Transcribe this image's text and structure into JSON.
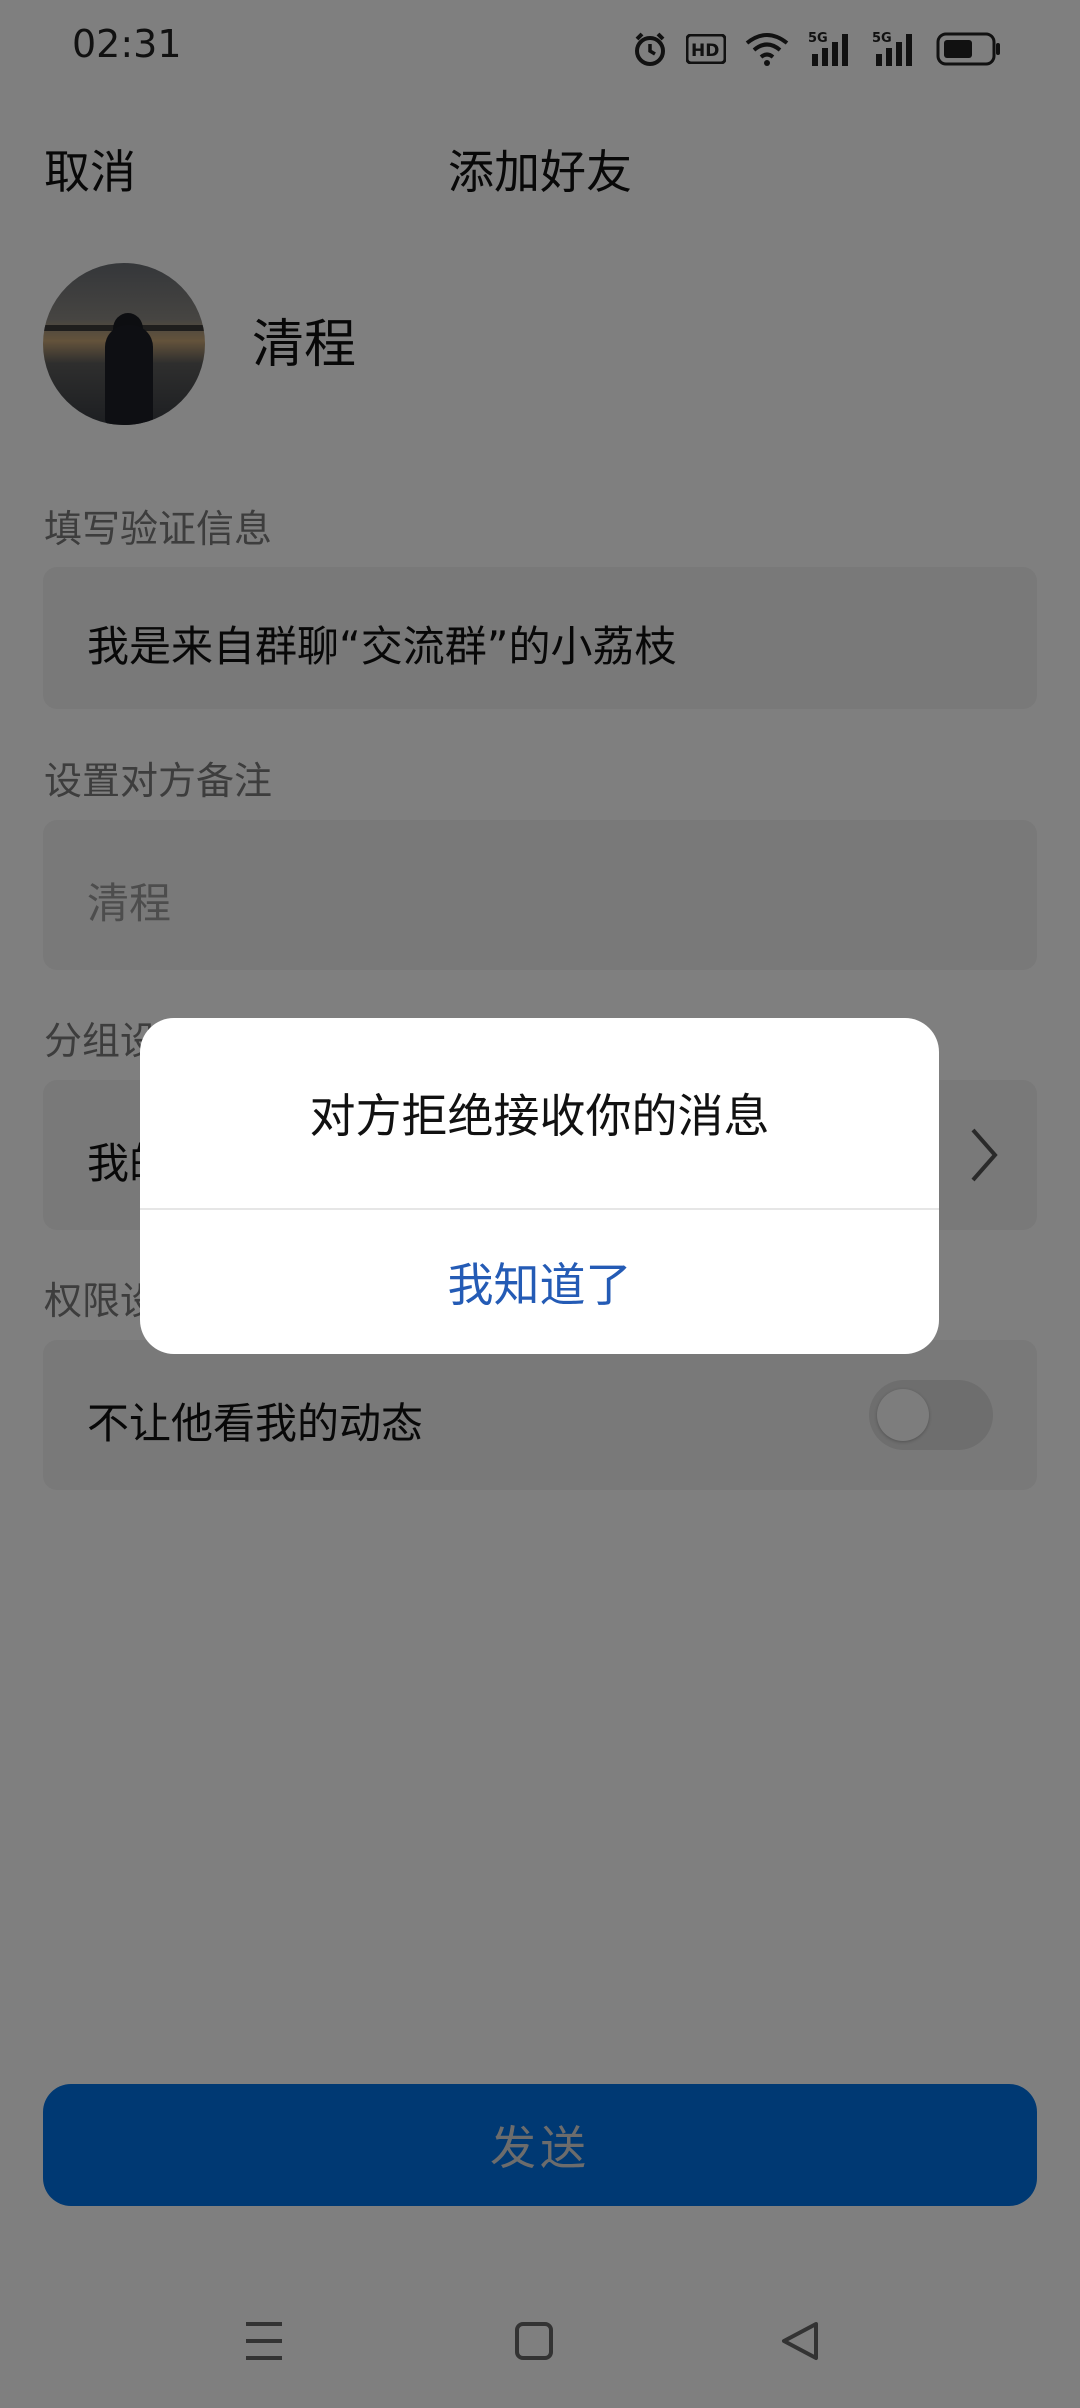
{
  "status_bar": {
    "time": "02:31",
    "icons": [
      "alarm-icon",
      "hd-icon",
      "wifi-icon",
      "signal-5g-icon",
      "signal-5g-icon",
      "battery-icon"
    ]
  },
  "header": {
    "cancel_label": "取消",
    "title": "添加好友"
  },
  "profile": {
    "name": "清程"
  },
  "verification": {
    "label": "填写验证信息",
    "value": "我是来自群聊“交流群”的小荔枝"
  },
  "remark": {
    "label": "设置对方备注",
    "placeholder": "清程"
  },
  "group": {
    "label": "分组设置",
    "value": "我的好友"
  },
  "permission": {
    "label": "权限设置",
    "item_label": "不让他看我的动态",
    "toggle_on": false
  },
  "send_button": {
    "label": "发送"
  },
  "dialog": {
    "message": "对方拒绝接收你的消息",
    "button_label": "我知道了"
  },
  "colors": {
    "accent": "#0073e6",
    "dialog_button": "#245bb5"
  }
}
